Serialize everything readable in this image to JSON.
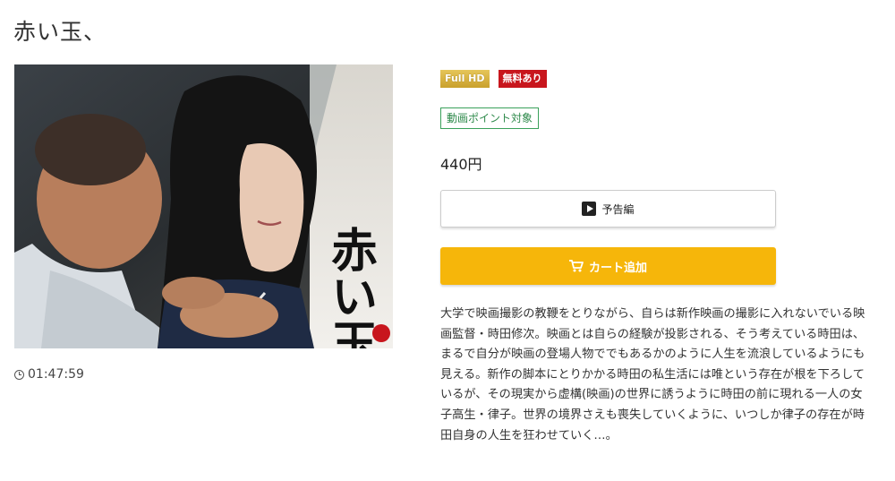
{
  "page": {
    "title": "赤い玉、"
  },
  "thumbnail": {
    "alt": "赤い玉、",
    "overlay_text": "赤い玉"
  },
  "duration": {
    "icon": "clock-icon",
    "value": "01:47:59"
  },
  "badges": {
    "hd": "Full HD",
    "free": "無料あり",
    "point": "動画ポイント対象"
  },
  "price": "440円",
  "buttons": {
    "trailer_label": "予告編",
    "trailer_icon": "play-icon",
    "cart_label": "カート追加",
    "cart_icon": "cart-icon"
  },
  "colors": {
    "cart_button": "#f6b60a",
    "free_badge": "#c8161d",
    "hd_badge": "#d4b040",
    "point_badge": "#3aa05a"
  },
  "description": "大学で映画撮影の教鞭をとりながら、自らは新作映画の撮影に入れないでいる映画監督・時田修次。映画とは自らの経験が投影される、そう考えている時田は、まるで自分が映画の登場人物ででもあるかのように人生を流浪しているようにも見える。新作の脚本にとりかかる時田の私生活には唯という存在が根を下ろしているが、その現実から虚構(映画)の世界に誘うように時田の前に現れる一人の女子高生・律子。世界の境界さえも喪失していくように、いつしか律子の存在が時田自身の人生を狂わせていく…。"
}
